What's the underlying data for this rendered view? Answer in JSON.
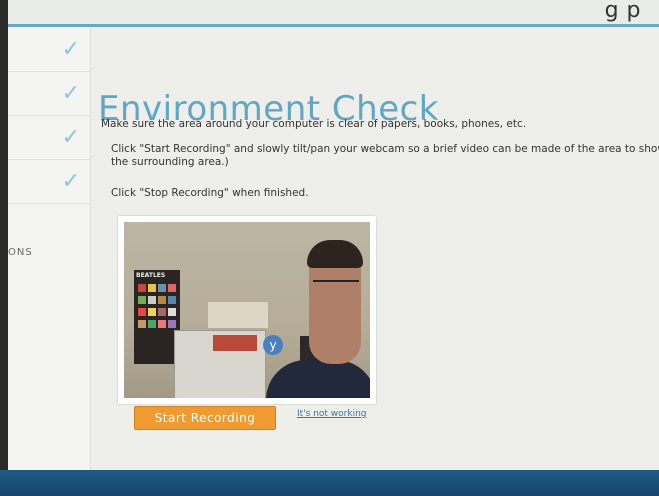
{
  "header": {
    "partial_text": "g      p"
  },
  "sidebar": {
    "steps": [
      {
        "checked": true
      },
      {
        "checked": true
      },
      {
        "checked": true
      },
      {
        "checked": true
      }
    ],
    "partial_label": "ONS",
    "check_icon": "check-icon"
  },
  "main": {
    "title": "Environment Check",
    "instruction_1": "Make sure the area around your computer is clear of papers, books, phones, etc.",
    "instruction_2": "Click \"Start Recording\" and slowly tilt/pan your webcam so a brief video can be made of the area to show the surrounding area.)",
    "instruction_3": "Click \"Stop Recording\" when finished.",
    "webcam": {
      "poster_title": "BEATLES",
      "sticker_letter": "y"
    },
    "start_button": "Start Recording",
    "not_working_link": "It's not working"
  },
  "colors": {
    "accent": "#5fa7c4",
    "button": "#f09a32",
    "link": "#3c74a8"
  }
}
